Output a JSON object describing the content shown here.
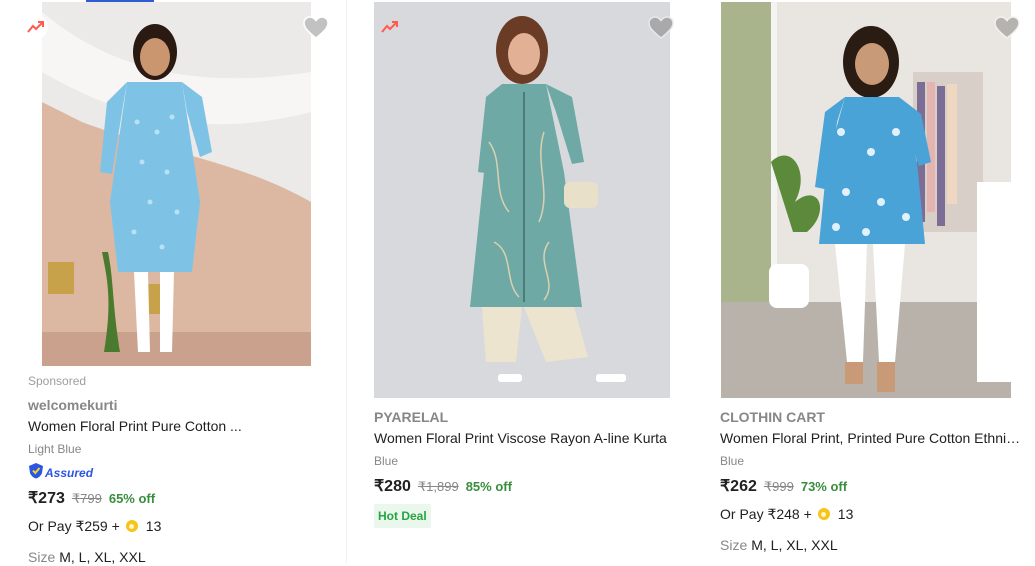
{
  "products": [
    {
      "sponsored": "Sponsored",
      "brand": "welcomekurti",
      "title": "Women Floral Print Pure Cotton ...",
      "color": "Light Blue",
      "assured": "Assured",
      "price": "₹273",
      "mrp": "₹799",
      "discount": "65% off",
      "or_pay": "Or Pay ₹259 +",
      "coins": "13",
      "size_label": "Size",
      "sizes": "M, L, XL, XXL",
      "icons": [
        "trending-icon",
        "heart-icon",
        "assured-badge-icon",
        "supercoin-icon"
      ]
    },
    {
      "brand": "PYARELAL",
      "title": "Women Floral Print Viscose Rayon A-line Kurta",
      "color": "Blue",
      "price": "₹280",
      "mrp": "₹1,899",
      "discount": "85% off",
      "badge": "Hot Deal",
      "icons": [
        "trending-icon",
        "heart-icon"
      ]
    },
    {
      "brand": "CLOTHIN CART",
      "title": "Women Floral Print, Printed Pure Cotton Ethnic Top",
      "color": "Blue",
      "price": "₹262",
      "mrp": "₹999",
      "discount": "73% off",
      "or_pay": "Or Pay ₹248 +",
      "coins": "13",
      "size_label": "Size",
      "sizes": "M, L, XL, XXL",
      "icons": [
        "heart-icon",
        "supercoin-icon"
      ]
    }
  ],
  "colors": {
    "discount": "#388e3c",
    "assured": "#2a55e5",
    "trend": "#ff5a4c",
    "hot_deal_bg": "#e9f7ec",
    "coin": "#f6c41a"
  }
}
